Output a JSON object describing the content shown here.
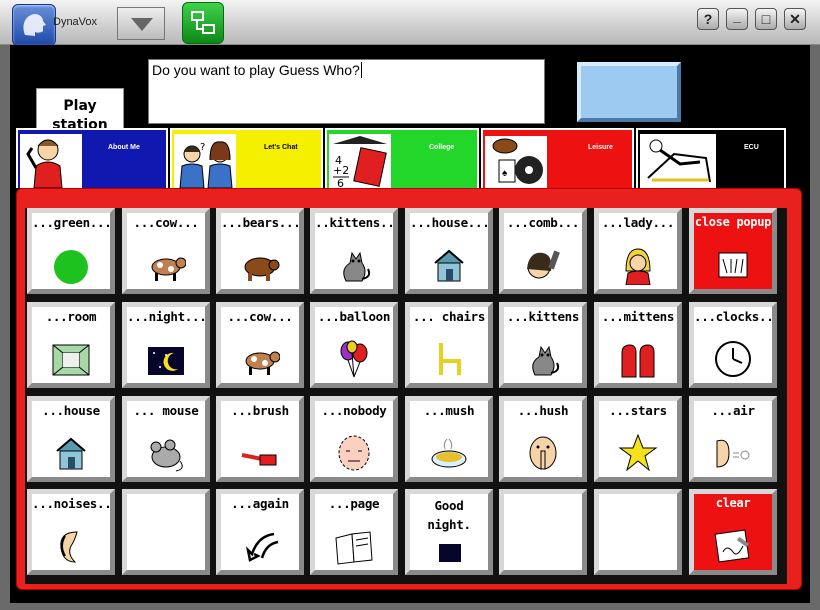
{
  "app": {
    "brand": "DynaVox"
  },
  "window_buttons": [
    "?",
    "_",
    "□",
    "✕"
  ],
  "message": {
    "text": "Do you want to play Guess Who?"
  },
  "play_station": {
    "label": "Play station"
  },
  "tabs": [
    {
      "label": "About Me",
      "color": "#1018b0",
      "label_color": "#ffffff"
    },
    {
      "label": "Let's Chat",
      "color": "#f5f000",
      "label_color": "#000000"
    },
    {
      "label": "College",
      "color": "#22d62a",
      "label_color": "#ffffff"
    },
    {
      "label": "Leisure",
      "color": "#ee1111",
      "label_color": "#ffffff"
    },
    {
      "label": "ECU",
      "color": "#000000",
      "label_color": "#ffffff"
    }
  ],
  "grid": [
    [
      {
        "label": "...green...",
        "icon": "green-dot-icon"
      },
      {
        "label": "...cow...",
        "icon": "cow-icon"
      },
      {
        "label": "...bears...",
        "icon": "bear-icon"
      },
      {
        "label": "..kittens..",
        "icon": "cat-icon"
      },
      {
        "label": "...house...",
        "icon": "house-icon"
      },
      {
        "label": "...comb...",
        "icon": "comb-icon"
      },
      {
        "label": "...lady...",
        "icon": "lady-icon"
      },
      {
        "label": "close popup",
        "icon": "close-popup-icon",
        "red": true
      }
    ],
    [
      {
        "label": "...room",
        "icon": "room-icon"
      },
      {
        "label": "...night...",
        "icon": "night-icon"
      },
      {
        "label": "...cow...",
        "icon": "cow-icon"
      },
      {
        "label": "...balloon",
        "icon": "balloon-icon"
      },
      {
        "label": "... chairs",
        "icon": "chair-icon"
      },
      {
        "label": "...kittens",
        "icon": "cat-icon"
      },
      {
        "label": "...mittens",
        "icon": "mittens-icon"
      },
      {
        "label": "...clocks...",
        "icon": "clock-icon"
      }
    ],
    [
      {
        "label": "...house",
        "icon": "house-icon"
      },
      {
        "label": "... mouse",
        "icon": "mouse-icon"
      },
      {
        "label": "...brush",
        "icon": "brush-icon"
      },
      {
        "label": "...nobody",
        "icon": "nobody-icon"
      },
      {
        "label": "...mush",
        "icon": "mush-icon"
      },
      {
        "label": "...hush",
        "icon": "hush-icon"
      },
      {
        "label": "...stars",
        "icon": "star-icon"
      },
      {
        "label": "...air",
        "icon": "air-icon"
      }
    ],
    [
      {
        "label": "...noises...",
        "icon": "ear-icon"
      },
      {
        "label": "",
        "icon": ""
      },
      {
        "label": "...again",
        "icon": "again-icon"
      },
      {
        "label": "...page",
        "icon": "book-icon"
      },
      {
        "label": "Good night.",
        "icon": "good-night-icon"
      },
      {
        "label": "",
        "icon": ""
      },
      {
        "label": "",
        "icon": ""
      },
      {
        "label": "clear",
        "icon": "clear-icon",
        "red": true
      }
    ]
  ]
}
